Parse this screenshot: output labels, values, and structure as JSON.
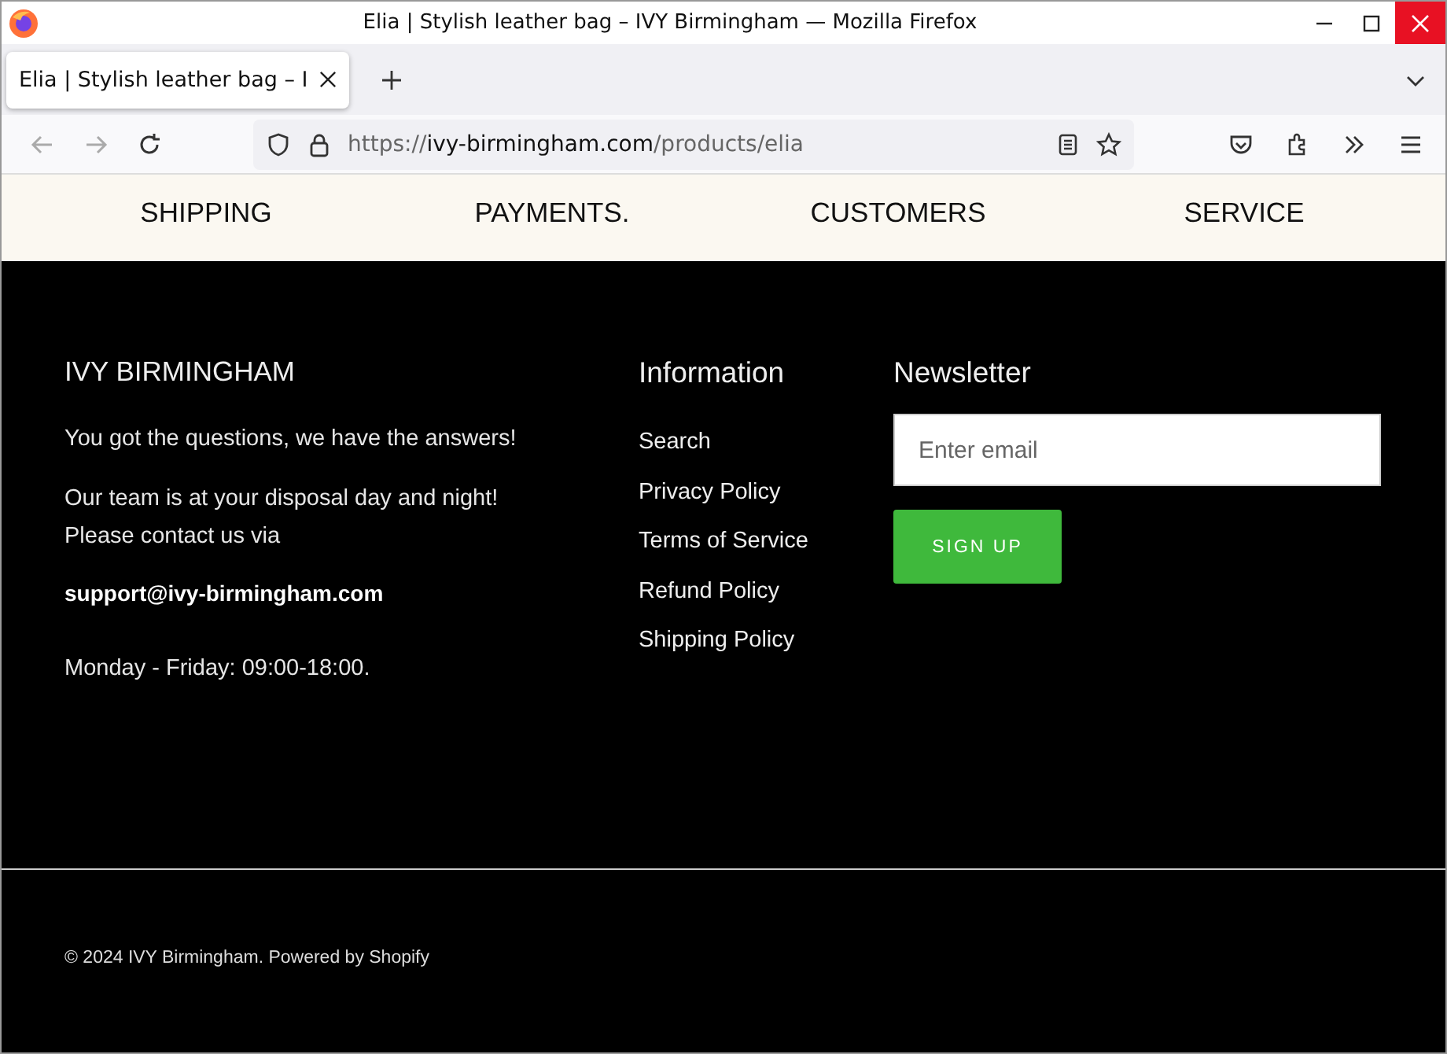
{
  "window": {
    "title": "Elia | Stylish leather bag – IVY Birmingham — Mozilla Firefox"
  },
  "tabs": [
    {
      "label": "Elia | Stylish leather bag – I",
      "selected": true
    }
  ],
  "address_bar": {
    "scheme": "https://",
    "domain": "ivy-birmingham.com",
    "path": "/products/elia"
  },
  "features": [
    {
      "line2": "SHIPPING"
    },
    {
      "line2": "PAYMENTS."
    },
    {
      "line2": "CUSTOMERS"
    },
    {
      "line2": "SERVICE"
    }
  ],
  "footer": {
    "brand": {
      "title": "IVY BIRMINGHAM",
      "tagline": "You got the questions, we have the answers!",
      "contact_lines": [
        "Our team is at your disposal day and night!",
        "Please contact us via"
      ],
      "email": "support@ivy-birmingham.com",
      "hours": "Monday - Friday: 09:00-18:00."
    },
    "information": {
      "title": "Information",
      "links": [
        "Search",
        "Privacy Policy",
        "Terms of Service",
        "Refund Policy",
        "Shipping Policy"
      ]
    },
    "newsletter": {
      "title": "Newsletter",
      "placeholder": "Enter email",
      "button": "SIGN UP"
    },
    "copyright": "© 2024 IVY Birmingham. Powered by Shopify"
  }
}
